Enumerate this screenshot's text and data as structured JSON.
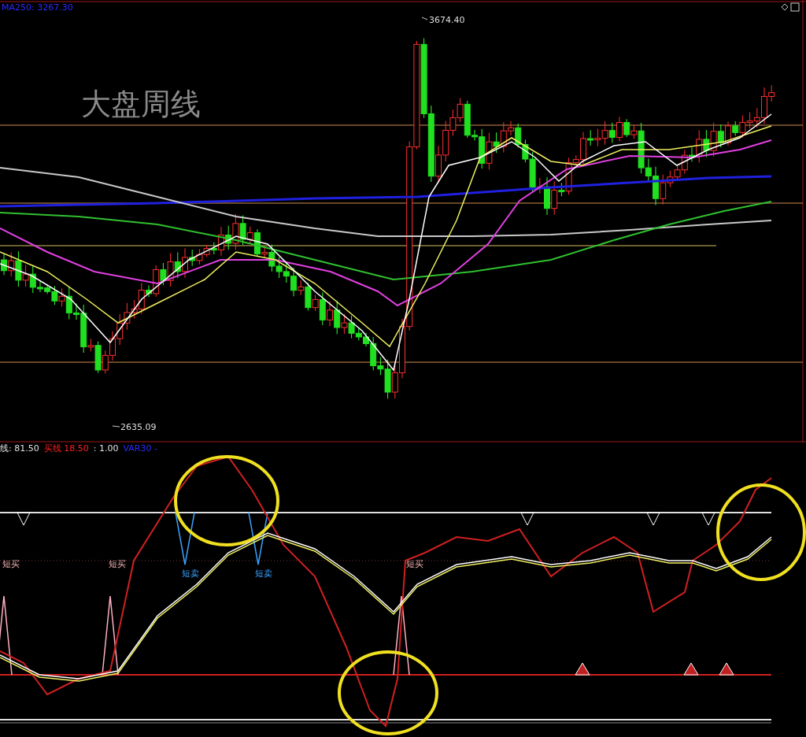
{
  "price_panel": {
    "header": "MA250: 3267.30",
    "chart_title": "大盘周线",
    "high_label": "3674.40",
    "low_label": "2635.09"
  },
  "indicator_panel": {
    "header": [
      {
        "text": "线: 81.50",
        "color": "#e0e0e0"
      },
      {
        "text": "买线 18.50",
        "color": "#ff2020"
      },
      {
        "text": ": 1.00",
        "color": "#e0e0e0"
      },
      {
        "text": "VAR30 -",
        "color": "#2a2aff"
      }
    ],
    "signals": [
      {
        "text": "短买",
        "kind": "buy"
      },
      {
        "text": "短买",
        "kind": "buy"
      },
      {
        "text": "短卖",
        "kind": "sell"
      },
      {
        "text": "短卖",
        "kind": "sell"
      },
      {
        "text": "短买",
        "kind": "buy"
      }
    ]
  }
}
